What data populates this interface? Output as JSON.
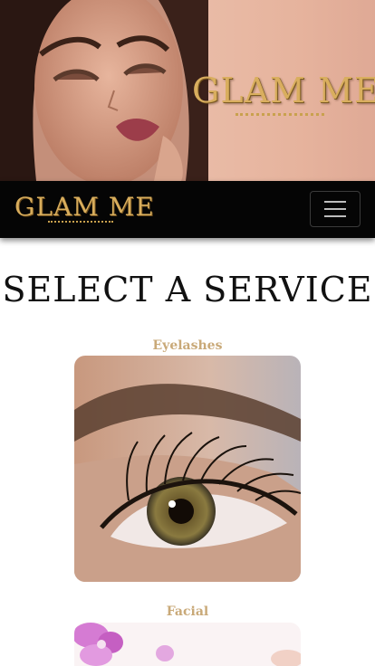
{
  "hero": {
    "logo_text": "GLAM ME",
    "photo": "woman-with-makeup-portrait"
  },
  "navbar": {
    "brand": "GLAM ME",
    "toggle_icon": "hamburger-menu-icon"
  },
  "main": {
    "title": "SELECT A SERVICE",
    "services": [
      {
        "label": "Eyelashes",
        "image": "eyelash-closeup-photo"
      },
      {
        "label": "Facial",
        "image": "orchid-flowers-photo"
      }
    ]
  },
  "colors": {
    "gold": "#d8ad5c",
    "label": "#c9a978",
    "navbar_bg": "#050505"
  }
}
